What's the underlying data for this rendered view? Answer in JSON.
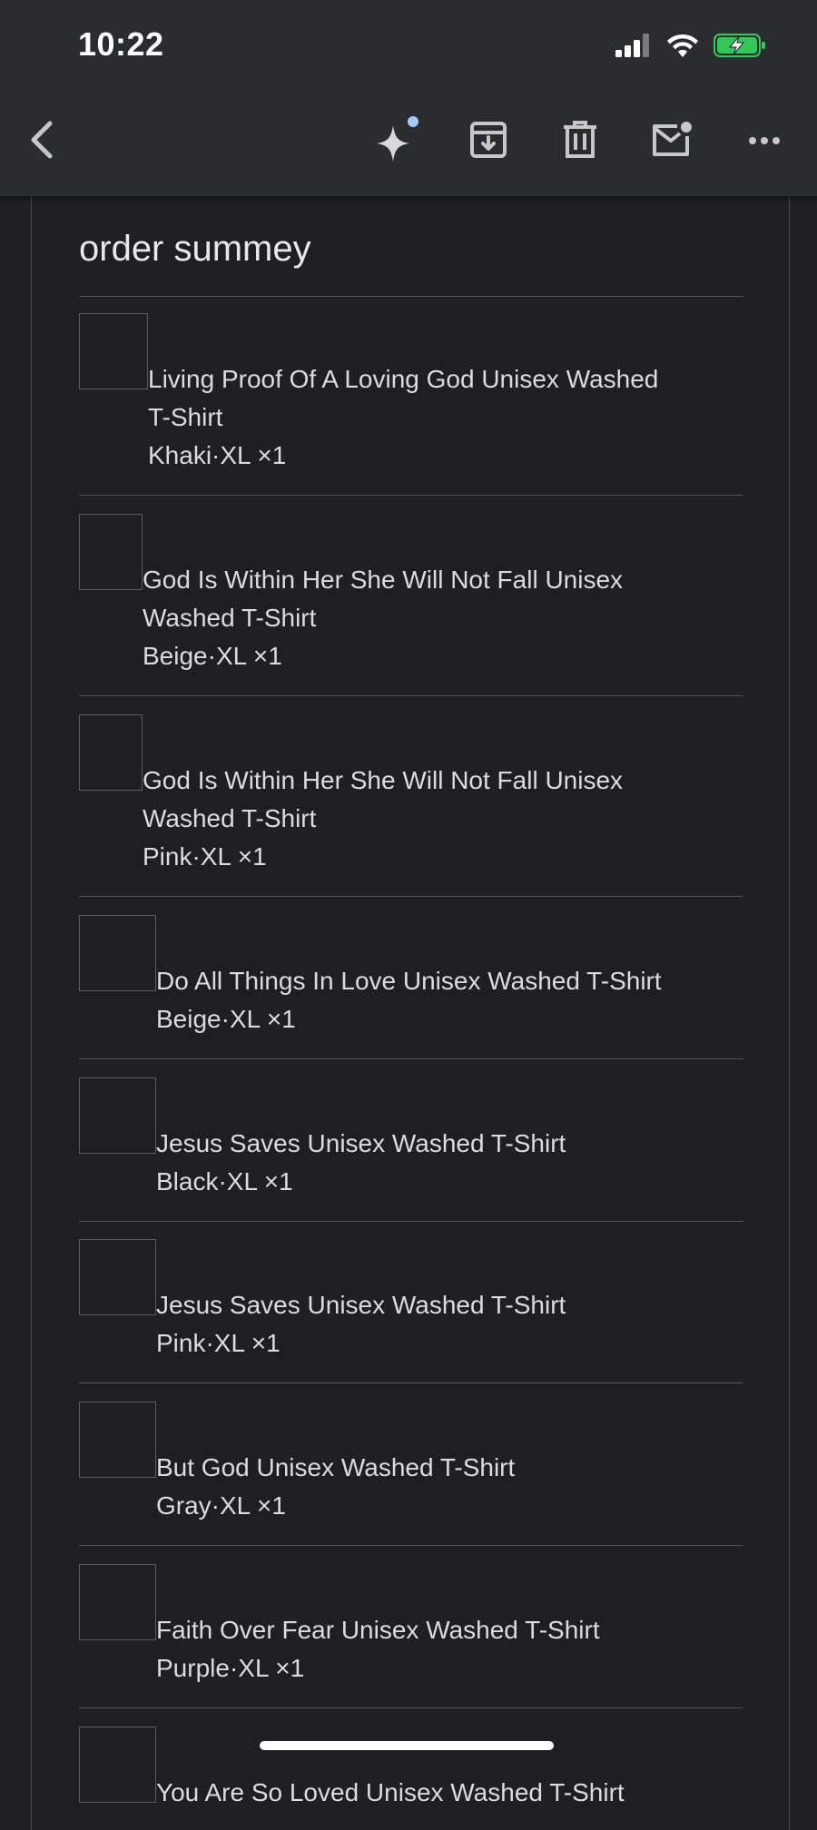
{
  "status_bar": {
    "time": "10:22"
  },
  "toolbar": {
    "icons": [
      "back-icon",
      "sparkle-icon",
      "archive-icon",
      "trash-icon",
      "mark-unread-icon",
      "more-icon"
    ]
  },
  "summary": {
    "title": "order summey",
    "items": [
      {
        "name_line1": "Living Proof Of A Loving God Unisex Washed",
        "name_line2": "T-Shirt",
        "variant": "Khaki·XL ×1"
      },
      {
        "name_line1": "God Is Within Her She Will Not Fall Unisex",
        "name_line2": "Washed T-Shirt",
        "variant": "Beige·XL ×1"
      },
      {
        "name_line1": "God Is Within Her She Will Not Fall Unisex",
        "name_line2": "Washed T-Shirt",
        "variant": "Pink·XL ×1"
      },
      {
        "name_line1": "Do All Things In Love Unisex Washed T-Shirt",
        "name_line2": "",
        "variant": "Beige·XL ×1"
      },
      {
        "name_line1": "Jesus Saves Unisex Washed T-Shirt",
        "name_line2": "",
        "variant": "Black·XL ×1"
      },
      {
        "name_line1": "Jesus Saves Unisex Washed T-Shirt",
        "name_line2": "",
        "variant": "Pink·XL ×1"
      },
      {
        "name_line1": "But God Unisex Washed T-Shirt",
        "name_line2": "",
        "variant": "Gray·XL ×1"
      },
      {
        "name_line1": "Faith Over Fear Unisex Washed T-Shirt",
        "name_line2": "",
        "variant": "Purple·XL ×1"
      },
      {
        "name_line1": "You Are So Loved Unisex Washed T-Shirt",
        "name_line2": "",
        "variant": ""
      }
    ]
  },
  "colors": {
    "background": "#1f1f23",
    "topbar": "#2b2c30",
    "battery_green": "#34c759",
    "sparkle_dot": "#a8c7fa"
  }
}
